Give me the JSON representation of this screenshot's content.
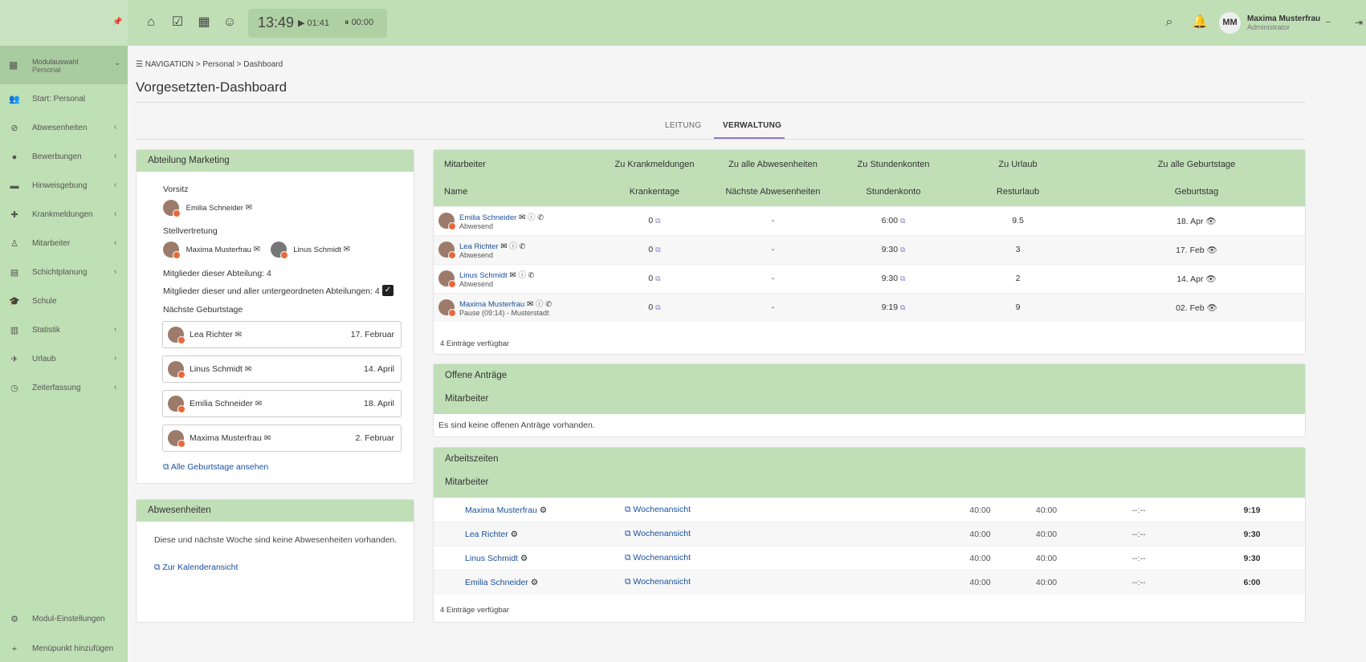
{
  "topbar": {
    "clock": "13:49",
    "timer1": "01:41",
    "timer2": "00:00",
    "user_initials": "MM",
    "user_name": "Maxima Musterfrau",
    "user_role": "Administrator"
  },
  "sidebar": {
    "module": {
      "label": "Modulauswahl",
      "sub": "Personal"
    },
    "items": [
      {
        "label": "Start: Personal",
        "icon": "people-icon",
        "chevron": false
      },
      {
        "label": "Abwesenheiten",
        "icon": "blocked-icon",
        "chevron": true
      },
      {
        "label": "Bewerbungen",
        "icon": "person-icon",
        "chevron": true
      },
      {
        "label": "Hinweisgebung",
        "icon": "feedback-icon",
        "chevron": true
      },
      {
        "label": "Krankmeldungen",
        "icon": "medical-icon",
        "chevron": true
      },
      {
        "label": "Mitarbeiter",
        "icon": "user-icon",
        "chevron": true
      },
      {
        "label": "Schichtplanung",
        "icon": "table-icon",
        "chevron": true
      },
      {
        "label": "Schule",
        "icon": "school-icon",
        "chevron": false
      },
      {
        "label": "Statistik",
        "icon": "chart-icon",
        "chevron": true
      },
      {
        "label": "Urlaub",
        "icon": "plane-icon",
        "chevron": true
      },
      {
        "label": "Zeiterfassung",
        "icon": "clock-icon",
        "chevron": true
      }
    ],
    "footer": [
      {
        "label": "Modul-Einstellungen"
      },
      {
        "label": "Menüpunkt hinzufügen"
      }
    ]
  },
  "breadcrumb": {
    "nav": "NAVIGATION",
    "p1": "Personal",
    "p2": "Dashboard"
  },
  "page_title": "Vorgesetzten-Dashboard",
  "tabs": {
    "leitung": "LEITUNG",
    "verwaltung": "VERWALTUNG"
  },
  "department": {
    "title": "Abteilung Marketing",
    "vorsitz_label": "Vorsitz",
    "vorsitz": "Emilia Schneider",
    "stellv_label": "Stellvertretung",
    "stellv": [
      "Maxima Musterfrau",
      "Linus Schmidt"
    ],
    "members": "Mitglieder dieser Abteilung: 4",
    "members_all": "Mitglieder dieser und aller untergeordneten Abteilungen: 4",
    "bday_label": "Nächste Geburtstage",
    "birthdays": [
      {
        "name": "Lea Richter",
        "date": "17. Februar"
      },
      {
        "name": "Linus Schmidt",
        "date": "14. April"
      },
      {
        "name": "Emilia Schneider",
        "date": "18. April"
      },
      {
        "name": "Maxima Musterfrau",
        "date": "2. Februar"
      }
    ],
    "all_bdays": "Alle Geburtstage ansehen"
  },
  "absences": {
    "title": "Abwesenheiten",
    "text": "Diese und nächste Woche sind keine Abwesenheiten vorhanden.",
    "link": "Zur Kalenderansicht"
  },
  "staff_table": {
    "head1": [
      "Mitarbeiter",
      "Zu Krankmeldungen",
      "Zu alle Abwesenheiten",
      "Zu Stundenkonten",
      "Zu Urlaub",
      "Zu alle Geburtstage"
    ],
    "head2": [
      "Name",
      "Krankentage",
      "Nächste Abwesenheiten",
      "Stundenkonto",
      "Resturlaub",
      "Geburtstag"
    ],
    "rows": [
      {
        "name": "Emilia Schneider",
        "status": "Abwesend",
        "sick": "0",
        "next": "-",
        "hours": "6:00",
        "vac": "9.5",
        "bday": "18. Apr"
      },
      {
        "name": "Lea Richter",
        "status": "Abwesend",
        "sick": "0",
        "next": "-",
        "hours": "9:30",
        "vac": "3",
        "bday": "17. Feb"
      },
      {
        "name": "Linus Schmidt",
        "status": "Abwesend",
        "sick": "0",
        "next": "-",
        "hours": "9:30",
        "vac": "2",
        "bday": "14. Apr"
      },
      {
        "name": "Maxima Musterfrau",
        "status": "Pause (09:14) - Musterstadt",
        "sick": "0",
        "next": "-",
        "hours": "9:19",
        "vac": "9",
        "bday": "02. Feb"
      }
    ],
    "footer": "4 Einträge verfügbar"
  },
  "requests": {
    "title": "Offene Anträge",
    "col": "Mitarbeiter",
    "empty": "Es sind keine offenen Anträge vorhanden."
  },
  "worktimes": {
    "title": "Arbeitszeiten",
    "col": "Mitarbeiter",
    "week_label": "Wochenansicht",
    "rows": [
      {
        "name": "Maxima Musterfrau",
        "a": "40:00",
        "b": "40:00",
        "c": "--:--",
        "d": "9:19"
      },
      {
        "name": "Lea Richter",
        "a": "40:00",
        "b": "40:00",
        "c": "--:--",
        "d": "9:30"
      },
      {
        "name": "Linus Schmidt",
        "a": "40:00",
        "b": "40:00",
        "c": "--:--",
        "d": "9:30"
      },
      {
        "name": "Emilia Schneider",
        "a": "40:00",
        "b": "40:00",
        "c": "--:--",
        "d": "6:00"
      }
    ],
    "footer": "4 Einträge verfügbar"
  },
  "colors": {
    "header_green": "#c0dfb7",
    "link_blue": "#1a4f9c",
    "tab_active": "#8e7cc3"
  }
}
